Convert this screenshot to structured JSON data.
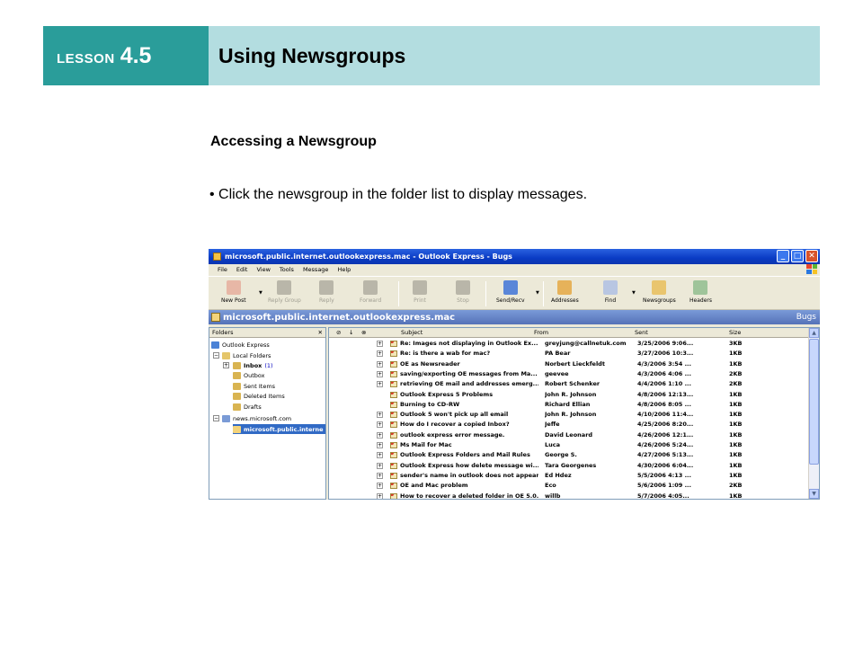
{
  "slide": {
    "lesson_word": "LESSON",
    "lesson_number": "4.5",
    "title": "Using Newsgroups",
    "subheading": "Accessing a Newsgroup",
    "bullet": "• Click the newsgroup in the folder list to display messages."
  },
  "colors": {
    "lesson_bg": "#2a9d9a",
    "title_bg": "#b3dde0",
    "titlebar": "#0a3bc4",
    "selection": "#316ac5"
  },
  "window": {
    "title": "microsoft.public.internet.outlookexpress.mac - Outlook Express - Bugs",
    "controls": {
      "minimize": "_",
      "maximize": "□",
      "close": "✕"
    },
    "menu": [
      "File",
      "Edit",
      "View",
      "Tools",
      "Message",
      "Help"
    ],
    "toolbar": [
      {
        "label": "New Post",
        "icon": "new-post-icon",
        "enabled": true
      },
      {
        "label": "Reply Group",
        "icon": "reply-group-icon",
        "enabled": false
      },
      {
        "label": "Reply",
        "icon": "reply-icon",
        "enabled": false
      },
      {
        "label": "Forward",
        "icon": "forward-icon",
        "enabled": false
      },
      {
        "label": "Print",
        "icon": "print-icon",
        "enabled": false
      },
      {
        "label": "Stop",
        "icon": "stop-icon",
        "enabled": false
      },
      {
        "label": "Send/Recv",
        "icon": "send-receive-icon",
        "enabled": true
      },
      {
        "label": "Addresses",
        "icon": "addresses-icon",
        "enabled": true
      },
      {
        "label": "Find",
        "icon": "find-icon",
        "enabled": true
      },
      {
        "label": "Newsgroups",
        "icon": "newsgroups-icon",
        "enabled": true
      },
      {
        "label": "Headers",
        "icon": "headers-icon",
        "enabled": true
      }
    ],
    "folder_bar": {
      "name": "microsoft.public.internet.outlookexpress.mac",
      "identity": "Bugs"
    },
    "folders_pane": {
      "header": "Folders",
      "close": "✕",
      "tree": {
        "root": "Outlook Express",
        "local_folders": "Local Folders",
        "inbox": "Inbox",
        "inbox_count": "(1)",
        "outbox": "Outbox",
        "sent_items": "Sent Items",
        "deleted_items": "Deleted Items",
        "drafts": "Drafts",
        "news_server": "news.microsoft.com",
        "selected_group": "microsoft.public.interne"
      }
    },
    "message_list": {
      "columns": {
        "subject": "Subject",
        "from": "From",
        "sent": "Sent",
        "size": "Size"
      },
      "rows": [
        {
          "subject": "Re: Images not displaying in Outlook Ex...",
          "from": "greyjung@callnetuk.com",
          "sent": "3/25/2006 9:06...",
          "size": "3KB",
          "expandable": true
        },
        {
          "subject": "Re: is there a wab for mac?",
          "from": "PA Bear",
          "sent": "3/27/2006 10:3...",
          "size": "1KB",
          "expandable": true
        },
        {
          "subject": "OE as Newsreader",
          "from": "Norbert Lieckfeldt",
          "sent": "4/3/2006 3:54 ...",
          "size": "1KB",
          "expandable": true
        },
        {
          "subject": "saving/exporting OE messages from Ma...",
          "from": "geevee",
          "sent": "4/3/2006 4:06 ...",
          "size": "2KB",
          "expandable": true
        },
        {
          "subject": "retrieving OE mail and addresses emerg...",
          "from": "Robert Schenker",
          "sent": "4/4/2006 1:10 ...",
          "size": "2KB",
          "expandable": true
        },
        {
          "subject": "Outlook Express 5 Problems",
          "from": "John R. Johnson",
          "sent": "4/8/2006 12:13...",
          "size": "1KB",
          "expandable": false
        },
        {
          "subject": "Burning to CD-RW",
          "from": "Richard Ellian",
          "sent": "4/8/2006 8:05 ...",
          "size": "1KB",
          "expandable": false
        },
        {
          "subject": "Outlook 5 won't pick up all email",
          "from": "John R. Johnson",
          "sent": "4/10/2006 11:4...",
          "size": "1KB",
          "expandable": true
        },
        {
          "subject": "How do I recover a copied Inbox?",
          "from": "Jeffe",
          "sent": "4/25/2006 8:20...",
          "size": "1KB",
          "expandable": true
        },
        {
          "subject": "outlook express error message.",
          "from": "David Leonard",
          "sent": "4/26/2006 12:1...",
          "size": "1KB",
          "expandable": true
        },
        {
          "subject": "Ms Mail for Mac",
          "from": "Luca",
          "sent": "4/26/2006 5:24...",
          "size": "1KB",
          "expandable": true
        },
        {
          "subject": "Outlook Express Folders and Mail Rules",
          "from": "George S.",
          "sent": "4/27/2006 5:13...",
          "size": "1KB",
          "expandable": true
        },
        {
          "subject": "Outlook Express how delete message wi...",
          "from": "Tara Georgenes",
          "sent": "4/30/2006 6:04...",
          "size": "1KB",
          "expandable": true
        },
        {
          "subject": "sender's name in outlook does not appear",
          "from": "Ed Hdez",
          "sent": "5/5/2006 4:13 ...",
          "size": "1KB",
          "expandable": true
        },
        {
          "subject": "OE and Mac problem",
          "from": "Eco",
          "sent": "5/6/2006 1:09 ...",
          "size": "2KB",
          "expandable": true
        },
        {
          "subject": "How to recover a deleted folder in OE 5.0...",
          "from": "willb",
          "sent": "5/7/2006 4:05...",
          "size": "1KB",
          "expandable": true
        }
      ]
    }
  }
}
